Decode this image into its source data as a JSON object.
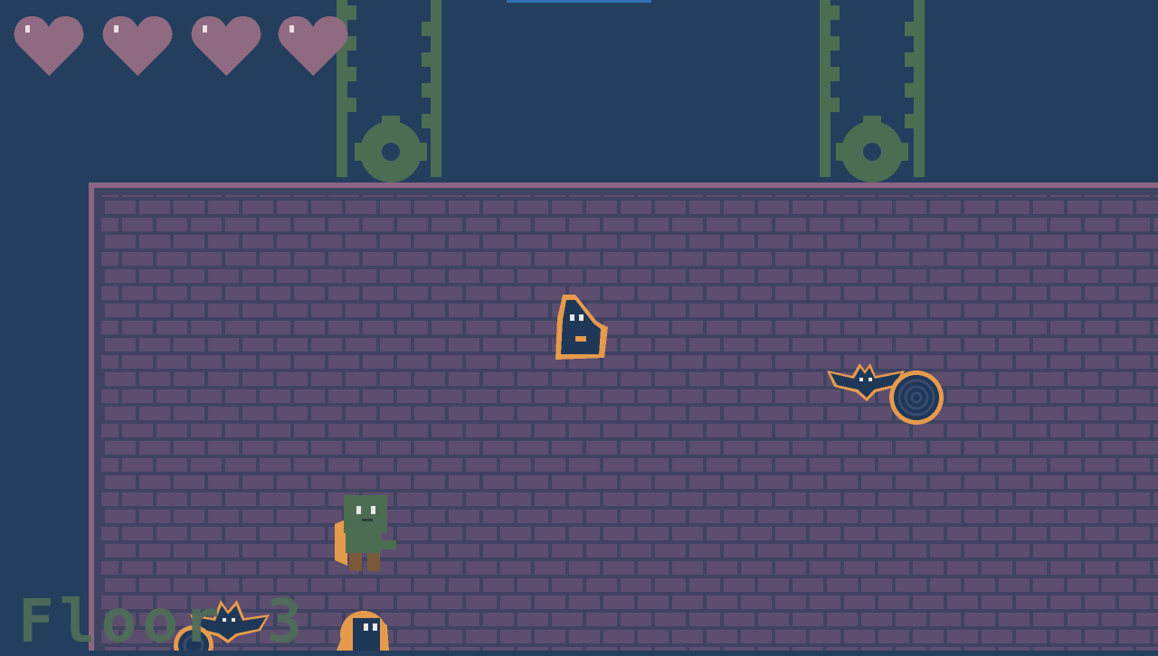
{
  "hud": {
    "hearts": {
      "current": 4,
      "max": 4
    },
    "floor_label": "Floor 3"
  },
  "colors": {
    "background": "#243e5d",
    "wall_border": "#8c6584",
    "brick": "#5d4d6f",
    "mortar": "#3f4361",
    "heart": "#8f6a80",
    "chain": "#4d6d53",
    "gear": "#4d6d53",
    "outline": "#e59a4c"
  },
  "icons": {
    "hearts": "heart-icon",
    "player": "zombie-player-icon",
    "enemies": [
      "hooded-ghost-icon",
      "bat-icon",
      "bat-icon",
      "blob-icon"
    ],
    "portal": "spiral-portal-icon",
    "decor": [
      "chain-icon",
      "gear-icon"
    ]
  }
}
